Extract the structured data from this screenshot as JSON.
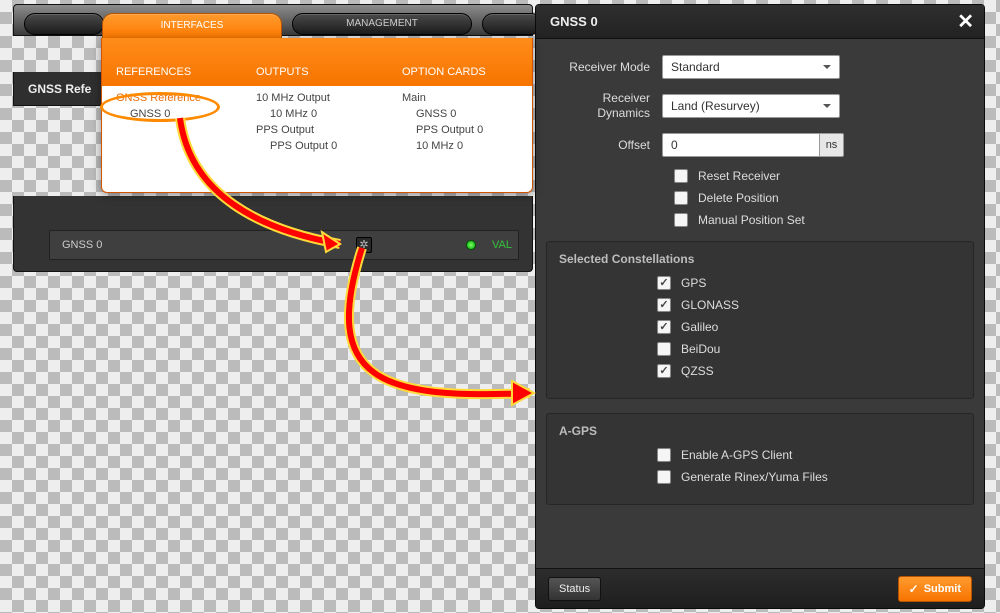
{
  "tabs": {
    "interfaces": "INTERFACES",
    "management": "MANAGEMENT"
  },
  "region_title": "GNSS Refe",
  "dropdown": {
    "header": {
      "references": "REFERENCES",
      "outputs": "OUTPUTS",
      "option_cards": "OPTION CARDS"
    },
    "refs": {
      "gnss_reference": "GNSS Reference",
      "gnss0": "GNSS 0"
    },
    "outputs": {
      "tenmhz": "10 MHz Output",
      "tenmhz0": "10 MHz 0",
      "pps": "PPS Output",
      "pps0": "PPS Output 0"
    },
    "cards": {
      "main": "Main",
      "gnss0": "GNSS 0",
      "pps0": "PPS Output 0",
      "tenmhz0": "10 MHz 0"
    }
  },
  "gnss_row": {
    "label": "GNSS 0",
    "status": "VAL"
  },
  "modal": {
    "title": "GNSS 0",
    "labels": {
      "receiver_mode": "Receiver Mode",
      "receiver_dynamics": "Receiver Dynamics",
      "offset": "Offset",
      "offset_unit": "ns"
    },
    "values": {
      "receiver_mode": "Standard",
      "receiver_dynamics": "Land (Resurvey)",
      "offset": "0"
    },
    "checkboxes": {
      "reset_receiver": "Reset Receiver",
      "delete_position": "Delete Position",
      "manual_position": "Manual Position Set",
      "gps": "GPS",
      "glonass": "GLONASS",
      "galileo": "Galileo",
      "beidou": "BeiDou",
      "qzss": "QZSS",
      "agps_client": "Enable A-GPS Client",
      "rinex": "Generate Rinex/Yuma Files"
    },
    "sections": {
      "constellations": "Selected Constellations",
      "agps": "A-GPS"
    },
    "buttons": {
      "status": "Status",
      "submit": "Submit"
    }
  }
}
